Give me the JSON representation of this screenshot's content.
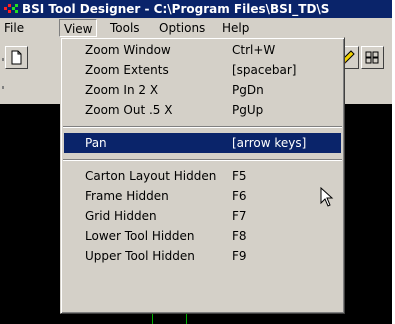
{
  "window": {
    "title": "BSI Tool Designer - C:\\Program Files\\BSI_TD\\S",
    "icon": "bsi-app-icon"
  },
  "menubar": {
    "items": [
      {
        "label": "File",
        "active": false
      },
      {
        "label": "View",
        "active": true
      },
      {
        "label": "Tools",
        "active": false
      },
      {
        "label": "Options",
        "active": false
      },
      {
        "label": "Help",
        "active": false
      }
    ]
  },
  "toolbar": {
    "buttons": [
      {
        "icon": "new-document-icon"
      },
      {
        "icon": "pencil-icon"
      },
      {
        "icon": "grid-icon"
      }
    ]
  },
  "view_menu": {
    "groups": [
      [
        {
          "label": "Zoom Window",
          "shortcut": "Ctrl+W"
        },
        {
          "label": "Zoom Extents",
          "shortcut": "[spacebar]"
        },
        {
          "label": "Zoom In 2 X",
          "shortcut": "PgDn"
        },
        {
          "label": "Zoom Out .5 X",
          "shortcut": "PgUp"
        }
      ],
      [
        {
          "label": "Pan",
          "shortcut": "[arrow keys]",
          "highlighted": true
        }
      ],
      [
        {
          "label": "Carton Layout Hidden",
          "shortcut": "F5"
        },
        {
          "label": "Frame Hidden",
          "shortcut": "F6"
        },
        {
          "label": "Grid Hidden",
          "shortcut": "F7"
        },
        {
          "label": "Lower Tool Hidden",
          "shortcut": "F8"
        },
        {
          "label": "Upper Tool Hidden",
          "shortcut": "F9"
        }
      ]
    ]
  },
  "colors": {
    "title_bar": "#0a246a",
    "highlight": "#0a246a",
    "menu_face": "#d4d0c8",
    "canvas": "#000000"
  }
}
